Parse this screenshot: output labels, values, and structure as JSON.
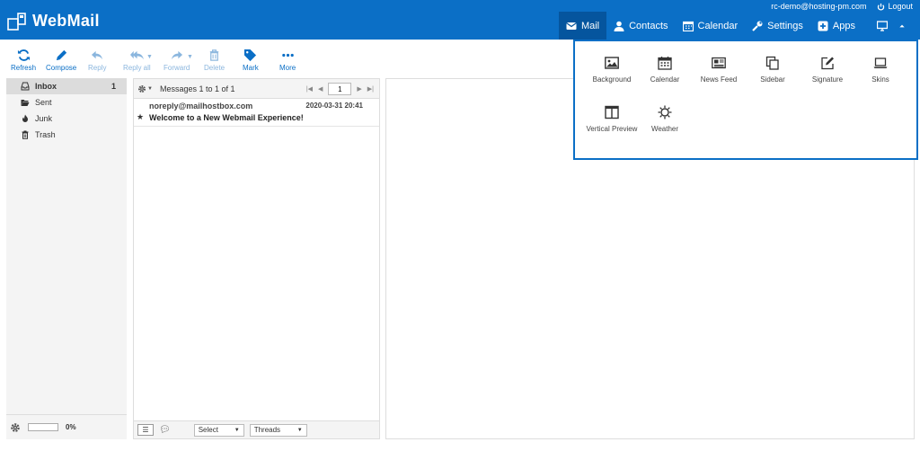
{
  "header": {
    "logo_text": "WebMail",
    "user_email": "rc-demo@hosting-pm.com",
    "logout_label": "Logout",
    "nav": [
      {
        "label": "Mail",
        "icon": "envelope-icon",
        "active": true
      },
      {
        "label": "Contacts",
        "icon": "user-icon"
      },
      {
        "label": "Calendar",
        "icon": "calendar-icon"
      },
      {
        "label": "Settings",
        "icon": "wrench-icon"
      },
      {
        "label": "Apps",
        "icon": "plus-square-icon"
      }
    ],
    "accent": "#0b6fc6"
  },
  "toolbar": {
    "refresh": "Refresh",
    "compose": "Compose",
    "reply": "Reply",
    "reply_all": "Reply all",
    "forward": "Forward",
    "delete": "Delete",
    "mark": "Mark",
    "more": "More"
  },
  "folders": [
    {
      "label": "Inbox",
      "count": "1",
      "icon": "inbox-icon"
    },
    {
      "label": "Sent",
      "count": "",
      "icon": "folder-open-icon"
    },
    {
      "label": "Junk",
      "count": "",
      "icon": "fire-icon"
    },
    {
      "label": "Trash",
      "count": "",
      "icon": "trash-icon"
    }
  ],
  "quota": {
    "text": "0%",
    "fraction": 0
  },
  "messagelist": {
    "count_text": "Messages 1 to 1 of 1",
    "page": "1",
    "messages": [
      {
        "from": "noreply@mailhostbox.com",
        "date": "2020-03-31 20:41",
        "subject": "Welcome to a New Webmail Experience!"
      }
    ],
    "select_label": "Select",
    "threads_label": "Threads"
  },
  "apps": [
    {
      "label": "Background",
      "icon": "image-icon"
    },
    {
      "label": "Calendar",
      "icon": "calendar-icon"
    },
    {
      "label": "News Feed",
      "icon": "newspaper-icon"
    },
    {
      "label": "Sidebar",
      "icon": "sidebar-icon"
    },
    {
      "label": "Signature",
      "icon": "pen-square-icon"
    },
    {
      "label": "Skins",
      "icon": "laptop-icon"
    },
    {
      "label": "Vertical Preview",
      "icon": "columns-icon"
    },
    {
      "label": "Weather",
      "icon": "sun-icon"
    }
  ]
}
